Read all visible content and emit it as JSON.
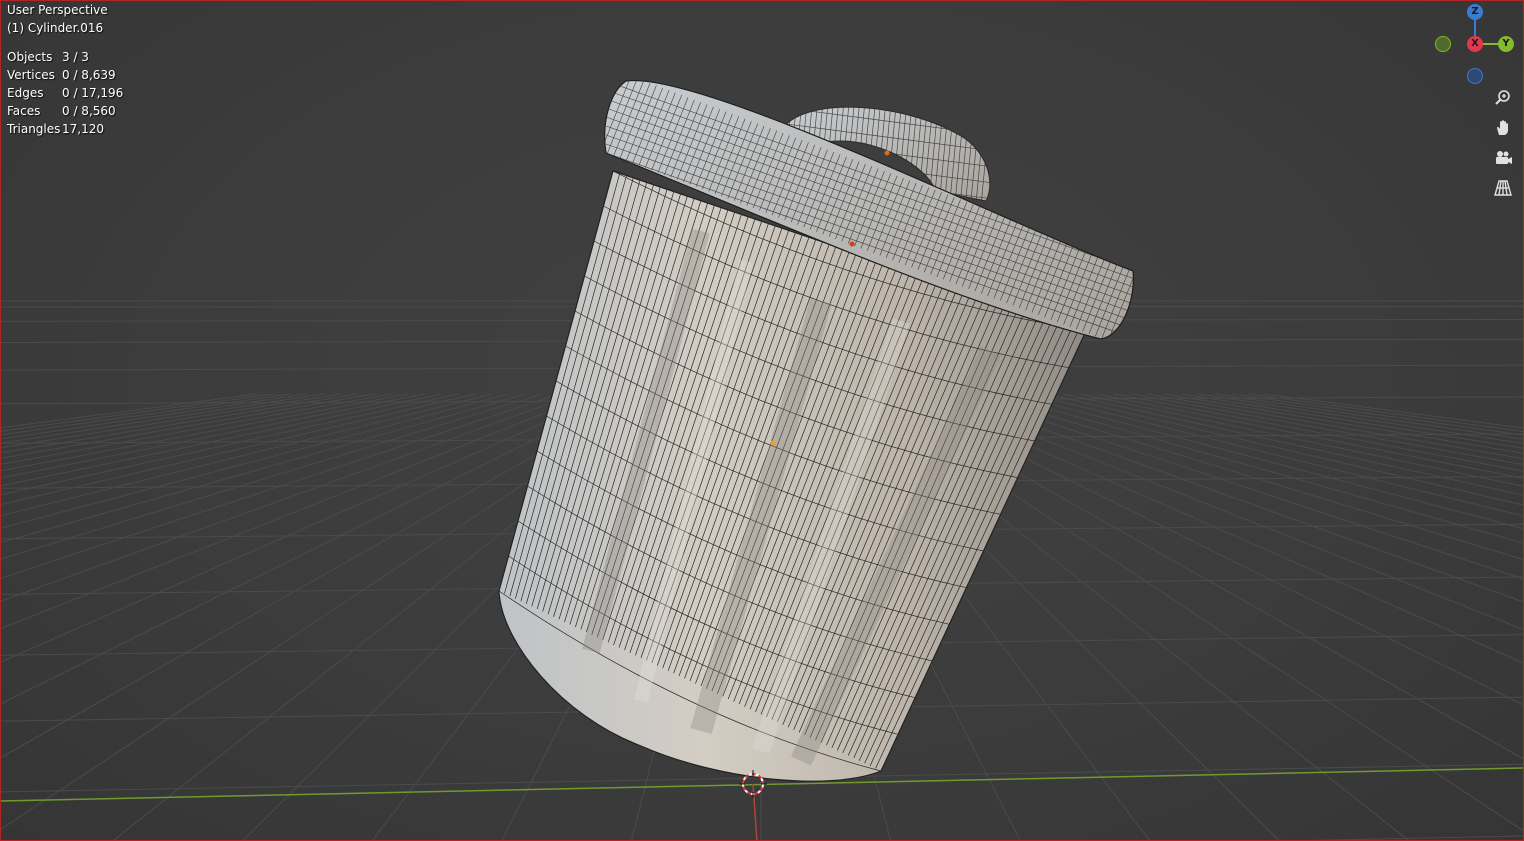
{
  "viewport": {
    "view_name": "User Perspective",
    "object_name": "(1) Cylinder.016"
  },
  "stats": [
    {
      "label": "Objects",
      "value": "3 / 3"
    },
    {
      "label": "Vertices",
      "value": "0 / 8,639"
    },
    {
      "label": "Edges",
      "value": "0 / 17,196"
    },
    {
      "label": "Faces",
      "value": "0 / 8,560"
    },
    {
      "label": "Triangles",
      "value": "17,120"
    }
  ],
  "gizmo": {
    "z_label": "Z",
    "x_label": "X",
    "y_label": "Y",
    "colors": {
      "x": "#e0394d",
      "y": "#84b82e",
      "z": "#3a7cd2"
    }
  },
  "nav_icons": [
    "zoom-icon",
    "hand-pan-icon",
    "camera-icon",
    "perspective-grid-icon"
  ],
  "colors": {
    "background": "#3d3d3d",
    "grid": "#4a4a4a",
    "x_axis": "#b4413a",
    "y_axis": "#6f9a2e",
    "mesh": "#c9c3b9",
    "wire": "#1e1e1e",
    "active_border": "#b32424"
  }
}
